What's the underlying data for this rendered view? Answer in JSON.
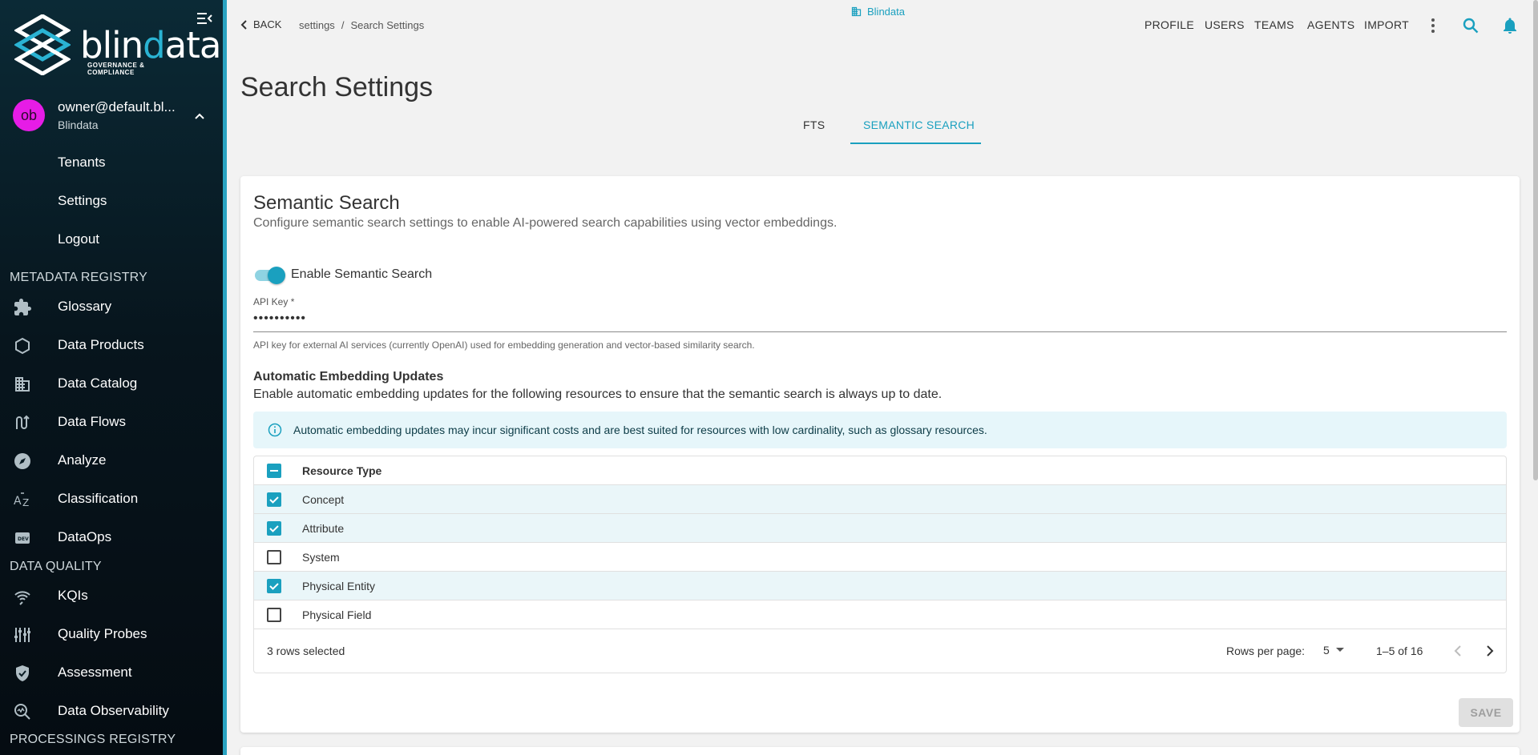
{
  "brand": {
    "name_pre": "blin",
    "name_dot": "d",
    "name_post": "ata",
    "tagline": "GOVERNANCE & COMPLIANCE",
    "accent": "#1aa0bf"
  },
  "user": {
    "initials": "ob",
    "email": "owner@default.bl...",
    "tenant": "Blindata"
  },
  "user_menu": [
    "Tenants",
    "Settings",
    "Logout"
  ],
  "sidebar": {
    "metadata_registry": {
      "title": "METADATA REGISTRY",
      "items": [
        {
          "label": "Glossary",
          "icon": "puzzle-icon"
        },
        {
          "label": "Data Products",
          "icon": "hexagon-icon"
        },
        {
          "label": "Data Catalog",
          "icon": "building-icon"
        },
        {
          "label": "Data Flows",
          "icon": "flow-icon"
        },
        {
          "label": "Analyze",
          "icon": "compass-icon"
        },
        {
          "label": "Classification",
          "icon": "sort-az-icon"
        },
        {
          "label": "DataOps",
          "icon": "dev-icon"
        }
      ]
    },
    "data_quality": {
      "title": "DATA QUALITY",
      "items": [
        {
          "label": "KQIs",
          "icon": "signal-icon"
        },
        {
          "label": "Quality Probes",
          "icon": "sliders-icon"
        },
        {
          "label": "Assessment",
          "icon": "shield-check-icon"
        },
        {
          "label": "Data Observability",
          "icon": "observability-icon"
        }
      ]
    },
    "processings_registry": {
      "title": "PROCESSINGS REGISTRY"
    }
  },
  "header": {
    "back_label": "BACK",
    "breadcrumb": [
      "settings",
      "Search Settings"
    ],
    "tenant": "Blindata",
    "nav": [
      "PROFILE",
      "USERS",
      "TEAMS",
      "AGENTS",
      "IMPORT"
    ]
  },
  "page": {
    "title": "Search Settings",
    "tabs": [
      {
        "label": "FTS",
        "active": false
      },
      {
        "label": "SEMANTIC SEARCH",
        "active": true
      }
    ]
  },
  "card": {
    "title": "Semantic Search",
    "subtitle": "Configure semantic search settings to enable AI-powered search capabilities using vector embeddings.",
    "toggle_label": "Enable Semantic Search",
    "toggle_on": true,
    "api_key_label": "API Key *",
    "api_key_value": "••••••••••",
    "api_key_help": "API key for external AI services (currently OpenAI) used for embedding generation and vector-based similarity search.",
    "auto_title": "Automatic Embedding Updates",
    "auto_desc": "Enable automatic embedding updates for the following resources to ensure that the semantic search is always up to date.",
    "alert": "Automatic embedding updates may incur significant costs and are best suited for resources with low cardinality, such as glossary resources.",
    "table": {
      "header": "Resource Type",
      "rows": [
        {
          "label": "Concept",
          "checked": true
        },
        {
          "label": "Attribute",
          "checked": true
        },
        {
          "label": "System",
          "checked": false
        },
        {
          "label": "Physical Entity",
          "checked": true
        },
        {
          "label": "Physical Field",
          "checked": false
        }
      ],
      "selected_text": "3 rows selected",
      "rows_per_page_label": "Rows per page:",
      "rows_per_page": "5",
      "range": "1–5 of 16"
    },
    "save_label": "SAVE"
  }
}
